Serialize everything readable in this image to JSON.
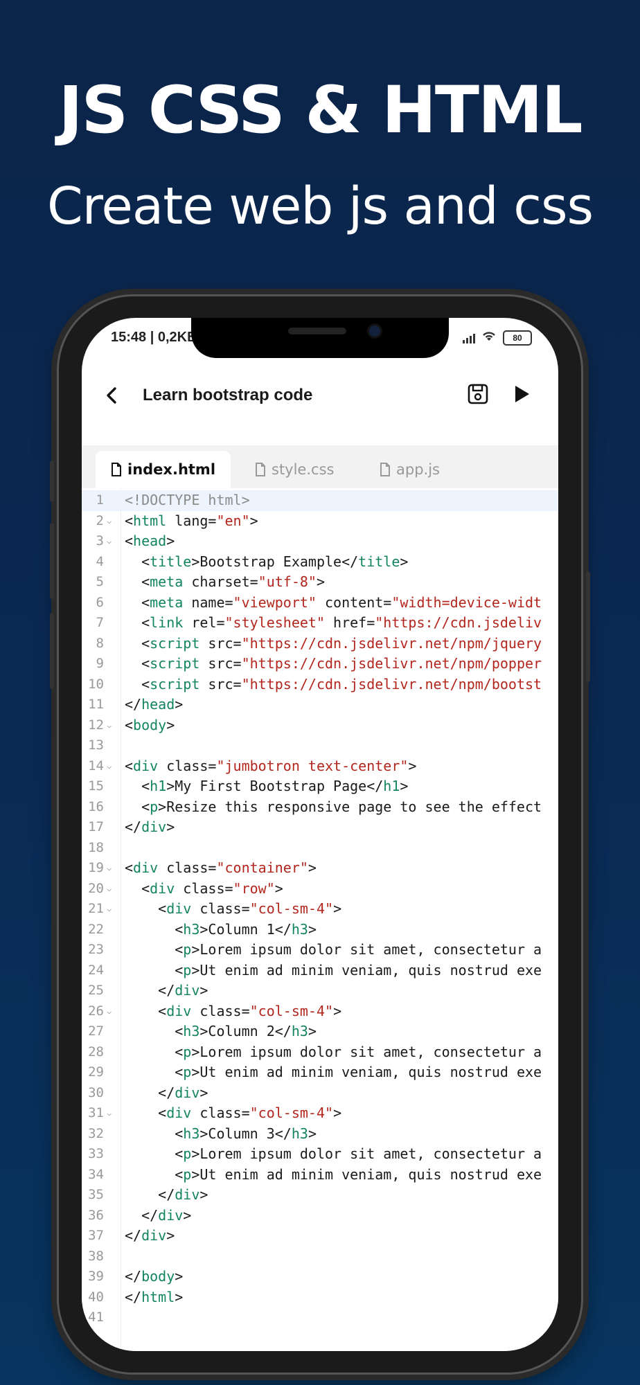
{
  "promo": {
    "title": "JS CSS & HTML",
    "subtitle": "Create web js and css"
  },
  "status": {
    "time": "15:48 | 0,2KB",
    "battery": "80"
  },
  "appbar": {
    "title": "Learn bootstrap code"
  },
  "tabs": [
    {
      "label": "index.html",
      "active": true
    },
    {
      "label": "style.css",
      "active": false
    },
    {
      "label": "app.js",
      "active": false
    }
  ],
  "colors": {
    "tag": "#138462",
    "string": "#b3261e",
    "doctype": "#8a8a8a",
    "text": "#1a1a1a",
    "current_line": "#edf4fd"
  },
  "code": [
    {
      "n": "1",
      "fold": false,
      "tokens": [
        [
          "doc",
          "<!DOCTYPE html>"
        ]
      ]
    },
    {
      "n": "2",
      "fold": true,
      "tokens": [
        [
          "p",
          "<"
        ],
        [
          "tag",
          "html"
        ],
        [
          "p",
          " lang="
        ],
        [
          "str",
          "\"en\""
        ],
        [
          "p",
          ">"
        ]
      ]
    },
    {
      "n": "3",
      "fold": true,
      "tokens": [
        [
          "p",
          "<"
        ],
        [
          "tag",
          "head"
        ],
        [
          "p",
          ">"
        ]
      ]
    },
    {
      "n": "4",
      "fold": false,
      "tokens": [
        [
          "p",
          "  <"
        ],
        [
          "tag",
          "title"
        ],
        [
          "p",
          ">Bootstrap Example</"
        ],
        [
          "tag",
          "title"
        ],
        [
          "p",
          ">"
        ]
      ]
    },
    {
      "n": "5",
      "fold": false,
      "tokens": [
        [
          "p",
          "  <"
        ],
        [
          "tag",
          "meta"
        ],
        [
          "p",
          " charset="
        ],
        [
          "str",
          "\"utf-8\""
        ],
        [
          "p",
          ">"
        ]
      ]
    },
    {
      "n": "6",
      "fold": false,
      "tokens": [
        [
          "p",
          "  <"
        ],
        [
          "tag",
          "meta"
        ],
        [
          "p",
          " name="
        ],
        [
          "str",
          "\"viewport\""
        ],
        [
          "p",
          " content="
        ],
        [
          "str",
          "\"width=device-widt"
        ]
      ]
    },
    {
      "n": "7",
      "fold": false,
      "tokens": [
        [
          "p",
          "  <"
        ],
        [
          "tag",
          "link"
        ],
        [
          "p",
          " rel="
        ],
        [
          "str",
          "\"stylesheet\""
        ],
        [
          "p",
          " href="
        ],
        [
          "str",
          "\"https://cdn.jsdeliv"
        ]
      ]
    },
    {
      "n": "8",
      "fold": false,
      "tokens": [
        [
          "p",
          "  <"
        ],
        [
          "tag",
          "script"
        ],
        [
          "p",
          " src="
        ],
        [
          "str",
          "\"https://cdn.jsdelivr.net/npm/jquery"
        ]
      ]
    },
    {
      "n": "9",
      "fold": false,
      "tokens": [
        [
          "p",
          "  <"
        ],
        [
          "tag",
          "script"
        ],
        [
          "p",
          " src="
        ],
        [
          "str",
          "\"https://cdn.jsdelivr.net/npm/popper"
        ]
      ]
    },
    {
      "n": "10",
      "fold": false,
      "tokens": [
        [
          "p",
          "  <"
        ],
        [
          "tag",
          "script"
        ],
        [
          "p",
          " src="
        ],
        [
          "str",
          "\"https://cdn.jsdelivr.net/npm/bootst"
        ]
      ]
    },
    {
      "n": "11",
      "fold": false,
      "tokens": [
        [
          "p",
          "</"
        ],
        [
          "tag",
          "head"
        ],
        [
          "p",
          ">"
        ]
      ]
    },
    {
      "n": "12",
      "fold": true,
      "tokens": [
        [
          "p",
          "<"
        ],
        [
          "tag",
          "body"
        ],
        [
          "p",
          ">"
        ]
      ]
    },
    {
      "n": "13",
      "fold": false,
      "tokens": []
    },
    {
      "n": "14",
      "fold": true,
      "tokens": [
        [
          "p",
          "<"
        ],
        [
          "tag",
          "div"
        ],
        [
          "p",
          " class="
        ],
        [
          "str",
          "\"jumbotron text-center\""
        ],
        [
          "p",
          ">"
        ]
      ]
    },
    {
      "n": "15",
      "fold": false,
      "tokens": [
        [
          "p",
          "  <"
        ],
        [
          "tag",
          "h1"
        ],
        [
          "p",
          ">My First Bootstrap Page</"
        ],
        [
          "tag",
          "h1"
        ],
        [
          "p",
          ">"
        ]
      ]
    },
    {
      "n": "16",
      "fold": false,
      "tokens": [
        [
          "p",
          "  <"
        ],
        [
          "tag",
          "p"
        ],
        [
          "p",
          ">Resize this responsive page to see the effect"
        ]
      ]
    },
    {
      "n": "17",
      "fold": false,
      "tokens": [
        [
          "p",
          "</"
        ],
        [
          "tag",
          "div"
        ],
        [
          "p",
          ">"
        ]
      ]
    },
    {
      "n": "18",
      "fold": false,
      "tokens": []
    },
    {
      "n": "19",
      "fold": true,
      "tokens": [
        [
          "p",
          "<"
        ],
        [
          "tag",
          "div"
        ],
        [
          "p",
          " class="
        ],
        [
          "str",
          "\"container\""
        ],
        [
          "p",
          ">"
        ]
      ]
    },
    {
      "n": "20",
      "fold": true,
      "tokens": [
        [
          "p",
          "  <"
        ],
        [
          "tag",
          "div"
        ],
        [
          "p",
          " class="
        ],
        [
          "str",
          "\"row\""
        ],
        [
          "p",
          ">"
        ]
      ]
    },
    {
      "n": "21",
      "fold": true,
      "tokens": [
        [
          "p",
          "    <"
        ],
        [
          "tag",
          "div"
        ],
        [
          "p",
          " class="
        ],
        [
          "str",
          "\"col-sm-4\""
        ],
        [
          "p",
          ">"
        ]
      ]
    },
    {
      "n": "22",
      "fold": false,
      "tokens": [
        [
          "p",
          "      <"
        ],
        [
          "tag",
          "h3"
        ],
        [
          "p",
          ">Column 1</"
        ],
        [
          "tag",
          "h3"
        ],
        [
          "p",
          ">"
        ]
      ]
    },
    {
      "n": "23",
      "fold": false,
      "tokens": [
        [
          "p",
          "      <"
        ],
        [
          "tag",
          "p"
        ],
        [
          "p",
          ">Lorem ipsum dolor sit amet, consectetur a"
        ]
      ]
    },
    {
      "n": "24",
      "fold": false,
      "tokens": [
        [
          "p",
          "      <"
        ],
        [
          "tag",
          "p"
        ],
        [
          "p",
          ">Ut enim ad minim veniam, quis nostrud exe"
        ]
      ]
    },
    {
      "n": "25",
      "fold": false,
      "tokens": [
        [
          "p",
          "    </"
        ],
        [
          "tag",
          "div"
        ],
        [
          "p",
          ">"
        ]
      ]
    },
    {
      "n": "26",
      "fold": true,
      "tokens": [
        [
          "p",
          "    <"
        ],
        [
          "tag",
          "div"
        ],
        [
          "p",
          " class="
        ],
        [
          "str",
          "\"col-sm-4\""
        ],
        [
          "p",
          ">"
        ]
      ]
    },
    {
      "n": "27",
      "fold": false,
      "tokens": [
        [
          "p",
          "      <"
        ],
        [
          "tag",
          "h3"
        ],
        [
          "p",
          ">Column 2</"
        ],
        [
          "tag",
          "h3"
        ],
        [
          "p",
          ">"
        ]
      ]
    },
    {
      "n": "28",
      "fold": false,
      "tokens": [
        [
          "p",
          "      <"
        ],
        [
          "tag",
          "p"
        ],
        [
          "p",
          ">Lorem ipsum dolor sit amet, consectetur a"
        ]
      ]
    },
    {
      "n": "29",
      "fold": false,
      "tokens": [
        [
          "p",
          "      <"
        ],
        [
          "tag",
          "p"
        ],
        [
          "p",
          ">Ut enim ad minim veniam, quis nostrud exe"
        ]
      ]
    },
    {
      "n": "30",
      "fold": false,
      "tokens": [
        [
          "p",
          "    </"
        ],
        [
          "tag",
          "div"
        ],
        [
          "p",
          ">"
        ]
      ]
    },
    {
      "n": "31",
      "fold": true,
      "tokens": [
        [
          "p",
          "    <"
        ],
        [
          "tag",
          "div"
        ],
        [
          "p",
          " class="
        ],
        [
          "str",
          "\"col-sm-4\""
        ],
        [
          "p",
          ">"
        ]
      ]
    },
    {
      "n": "32",
      "fold": false,
      "tokens": [
        [
          "p",
          "      <"
        ],
        [
          "tag",
          "h3"
        ],
        [
          "p",
          ">Column 3</"
        ],
        [
          "tag",
          "h3"
        ],
        [
          "p",
          ">"
        ]
      ]
    },
    {
      "n": "33",
      "fold": false,
      "tokens": [
        [
          "p",
          "      <"
        ],
        [
          "tag",
          "p"
        ],
        [
          "p",
          ">Lorem ipsum dolor sit amet, consectetur a"
        ]
      ]
    },
    {
      "n": "34",
      "fold": false,
      "tokens": [
        [
          "p",
          "      <"
        ],
        [
          "tag",
          "p"
        ],
        [
          "p",
          ">Ut enim ad minim veniam, quis nostrud exe"
        ]
      ]
    },
    {
      "n": "35",
      "fold": false,
      "tokens": [
        [
          "p",
          "    </"
        ],
        [
          "tag",
          "div"
        ],
        [
          "p",
          ">"
        ]
      ]
    },
    {
      "n": "36",
      "fold": false,
      "tokens": [
        [
          "p",
          "  </"
        ],
        [
          "tag",
          "div"
        ],
        [
          "p",
          ">"
        ]
      ]
    },
    {
      "n": "37",
      "fold": false,
      "tokens": [
        [
          "p",
          "</"
        ],
        [
          "tag",
          "div"
        ],
        [
          "p",
          ">"
        ]
      ]
    },
    {
      "n": "38",
      "fold": false,
      "tokens": []
    },
    {
      "n": "39",
      "fold": false,
      "tokens": [
        [
          "p",
          "</"
        ],
        [
          "tag",
          "body"
        ],
        [
          "p",
          ">"
        ]
      ]
    },
    {
      "n": "40",
      "fold": false,
      "tokens": [
        [
          "p",
          "</"
        ],
        [
          "tag",
          "html"
        ],
        [
          "p",
          ">"
        ]
      ]
    },
    {
      "n": "41",
      "fold": false,
      "tokens": []
    }
  ]
}
